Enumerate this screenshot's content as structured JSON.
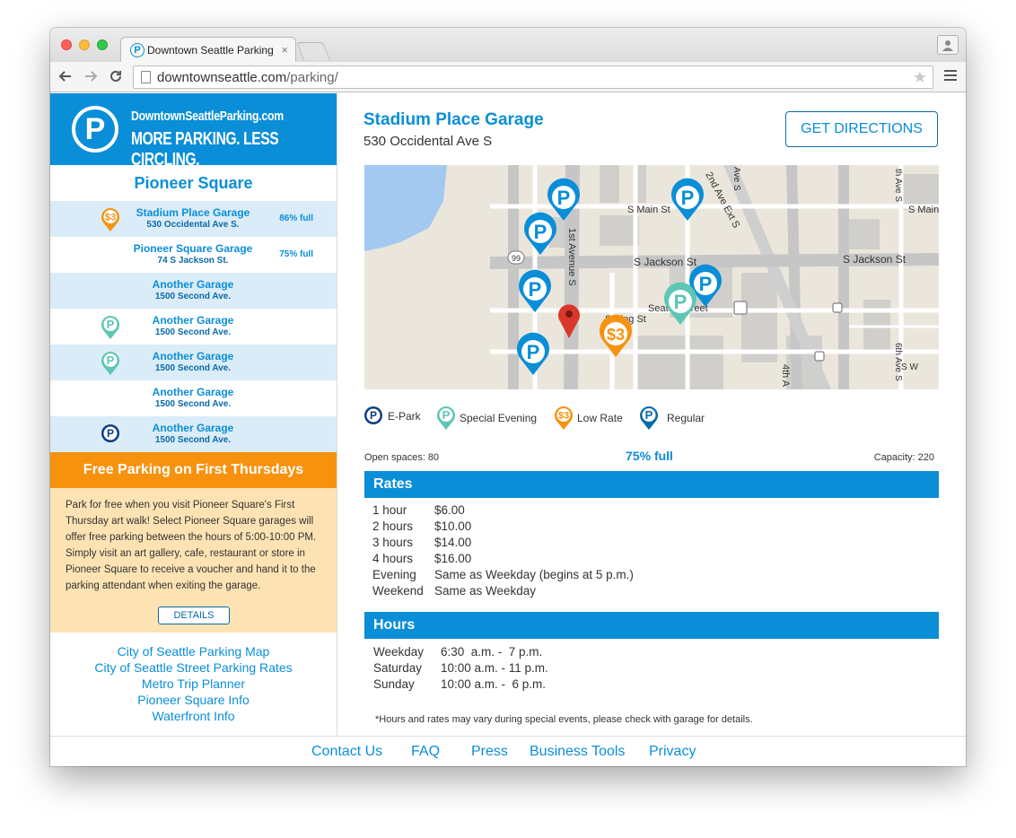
{
  "browser": {
    "tab_title": "Downtown Seattle Parking",
    "tab_close": "×",
    "url_host": "downtownseattle.com",
    "url_path": "/parking/"
  },
  "brand": {
    "logo_letter": "P",
    "domain": "DowntownSeattleParking.com",
    "tagline": "MORE PARKING. LESS CIRCLING."
  },
  "sidebar": {
    "area_title": "Pioneer Square",
    "garages": [
      {
        "name": "Stadium Place Garage",
        "address": "530 Occidental Ave S.",
        "full": "86% full",
        "pin": "low-rate"
      },
      {
        "name": "Pioneer Square Garage",
        "address": "74 S Jackson St.",
        "full": "75% full",
        "pin": ""
      },
      {
        "name": "Another Garage",
        "address": "1500 Second Ave.",
        "full": "",
        "pin": ""
      },
      {
        "name": "Another Garage",
        "address": "1500 Second Ave.",
        "full": "",
        "pin": "special-evening"
      },
      {
        "name": "Another Garage",
        "address": "1500 Second Ave.",
        "full": "",
        "pin": "special-evening"
      },
      {
        "name": "Another Garage",
        "address": "1500 Second Ave.",
        "full": "",
        "pin": ""
      },
      {
        "name": "Another Garage",
        "address": "1500 Second Ave.",
        "full": "",
        "pin": "e-park"
      }
    ],
    "promo": {
      "title": "Free Parking on First Thursdays",
      "body": "Park for free when you visit Pioneer Square's First Thursday art walk! Select Pioneer Square garages will offer free parking between the hours of 5:00-10:00 PM. Simply visit an art gallery, cafe, restaurant or store in Pioneer Square to receive a voucher and hand it to the parking attendant when exiting the garage.",
      "button": "DETAILS"
    },
    "links": [
      "City of Seattle Parking Map",
      "City of Seattle Street Parking Rates",
      "Metro Trip Planner",
      "Pioneer Square Info",
      "Waterfront Info"
    ]
  },
  "garage": {
    "title": "Stadium Place Garage",
    "address": "530 Occidental Ave S",
    "directions_button": "GET DIRECTIONS"
  },
  "map": {
    "streets": [
      "S Main St",
      "S Main",
      "S Jackson St",
      "S Jackson St",
      "S King St",
      "Seattle Street",
      "1st Avenue S",
      "2nd Ave Ext S",
      "Ave S",
      "th Ave S",
      "4th A",
      "6th Ave S",
      "S W"
    ],
    "route_badge": "99",
    "low_rate_label": "$3"
  },
  "legend": [
    {
      "label": "E-Park",
      "type": "e-park"
    },
    {
      "label": "Special Evening",
      "type": "special-evening"
    },
    {
      "label": "Low Rate",
      "type": "low-rate"
    },
    {
      "label": "Regular",
      "type": "regular"
    }
  ],
  "stats": {
    "open": "Open spaces: 80",
    "full": "75% full",
    "capacity": "Capacity: 220"
  },
  "rates": {
    "heading": "Rates",
    "rows": [
      {
        "label": "1 hour",
        "value": "$6.00"
      },
      {
        "label": "2 hours",
        "value": "$10.00"
      },
      {
        "label": "3 hours",
        "value": "$14.00"
      },
      {
        "label": "4 hours",
        "value": "$16.00"
      },
      {
        "label": "Evening",
        "value": "Same as Weekday (begins at 5 p.m.)"
      },
      {
        "label": "Weekend",
        "value": "Same as Weekday"
      }
    ]
  },
  "hours": {
    "heading": "Hours",
    "rows": [
      {
        "label": "Weekday",
        "value": "6:30  a.m. -  7 p.m."
      },
      {
        "label": "Saturday",
        "value": "10:00 a.m. - 11 p.m."
      },
      {
        "label": "Sunday",
        "value": "10:00 a.m. -  6 p.m."
      }
    ]
  },
  "note": "*Hours and rates may vary during special events, please check with garage for details.",
  "footer": [
    "Contact Us",
    "FAQ",
    "Press",
    "Business Tools",
    "Privacy"
  ],
  "colors": {
    "brand_blue": "#0a8ed8",
    "regular_blue": "#0a6aa8",
    "special_teal": "#5dc6b4",
    "low_orange": "#f7920f",
    "promo_bg": "#fde3b3",
    "row_alt": "#daecf8"
  }
}
